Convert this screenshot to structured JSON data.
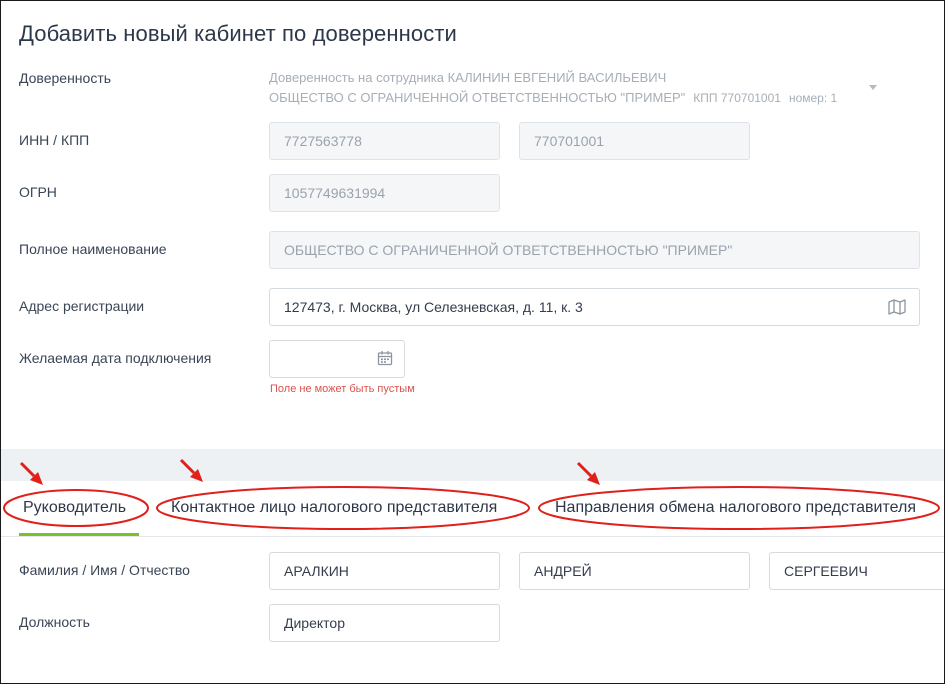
{
  "form": {
    "title": "Добавить новый кабинет по доверенности",
    "trust": {
      "label": "Доверенность",
      "line1": "Доверенность на сотрудника КАЛИНИН ЕВГЕНИЙ ВАСИЛЬЕВИЧ",
      "line2": "ОБЩЕСТВО С ОГРАНИЧЕННОЙ ОТВЕТСТВЕННОСТЬЮ \"ПРИМЕР\"",
      "kpp": "КПП 770701001",
      "number": "номер: 1"
    },
    "inn_kpp": {
      "label": "ИНН / КПП",
      "inn": "7727563778",
      "kpp": "770701001"
    },
    "ogrn": {
      "label": "ОГРН",
      "value": "1057749631994"
    },
    "full_name": {
      "label": "Полное наименование",
      "value": "ОБЩЕСТВО С ОГРАНИЧЕННОЙ ОТВЕТСТВЕННОСТЬЮ \"ПРИМЕР\""
    },
    "address": {
      "label": "Адрес регистрации",
      "value": "127473, г. Москва, ул Селезневская, д. 11, к. 3",
      "icon": "map-icon"
    },
    "date": {
      "label": "Желаемая дата подключения",
      "value": "",
      "icon": "calendar-icon",
      "error": "Поле не может быть пустым"
    }
  },
  "tabs": [
    {
      "label": "Руководитель",
      "active": true
    },
    {
      "label": "Контактное лицо налогового представителя",
      "active": false
    },
    {
      "label": "Направления обмена налогового представителя",
      "active": false
    }
  ],
  "director": {
    "fio_label": "Фамилия / Имя / Отчество",
    "last_name": "АРАЛКИН",
    "first_name": "АНДРЕЙ",
    "middle_name": "СЕРГЕЕВИЧ",
    "position_label": "Должность",
    "position": "Директор"
  },
  "colors": {
    "accent_green": "#7bbf2a",
    "error_red": "#d9534f",
    "annotation_red": "#e0201b"
  }
}
